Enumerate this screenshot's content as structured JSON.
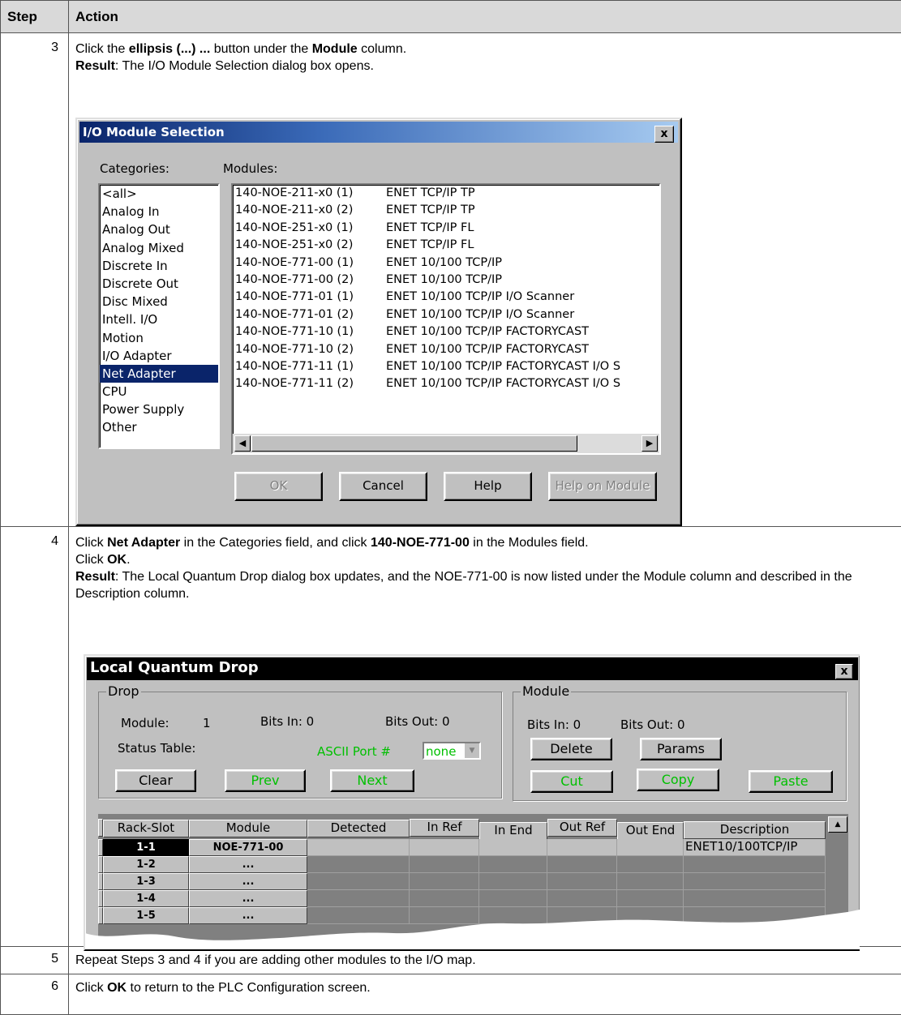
{
  "table": {
    "header": {
      "step": "Step",
      "action": "Action"
    },
    "rows": [
      {
        "step": "3",
        "l1_pre": "Click the ",
        "l1_b1": "ellipsis (...) ...",
        "l1_mid": " button under the ",
        "l1_b2": "Module",
        "l1_post": " column.",
        "l2_b": "Result",
        "l2_text": ": The I/O Module Selection dialog box opens."
      },
      {
        "step": "4",
        "l1_pre": "Click ",
        "l1_b1": "Net Adapter",
        "l1_mid": " in the Categories field, and click ",
        "l1_b2": "140-NOE-771-00",
        "l1_post": " in the Modules field.",
        "l2_pre": "Click ",
        "l2_b": "OK",
        "l2_post": ".",
        "l3_b": "Result",
        "l3_text": ": The Local Quantum Drop dialog box updates, and the NOE-771-00 is now listed under the Module column and described in the Description column."
      },
      {
        "step": "5",
        "text": "Repeat Steps 3 and 4 if you are adding other modules to the I/O map."
      },
      {
        "step": "6",
        "pre": "Click ",
        "b": "OK",
        "post": " to return to the PLC Configuration screen."
      }
    ]
  },
  "dialog1": {
    "title": "I/O Module Selection",
    "close": "x",
    "categories_label": "Categories:",
    "modules_label": "Modules:",
    "categories": [
      "<all>",
      "Analog In",
      "Analog Out",
      "Analog Mixed",
      "Discrete In",
      "Discrete Out",
      "Disc Mixed",
      "Intell. I/O",
      "Motion",
      "I/O Adapter",
      "Net Adapter",
      "CPU",
      "Power Supply",
      "Other"
    ],
    "selected_category": "Net Adapter",
    "modules": [
      [
        "140-NOE-211-x0 (1)",
        "ENET TCP/IP TP"
      ],
      [
        "140-NOE-211-x0 (2)",
        "ENET TCP/IP TP"
      ],
      [
        "140-NOE-251-x0 (1)",
        "ENET TCP/IP FL"
      ],
      [
        "140-NOE-251-x0 (2)",
        "ENET TCP/IP FL"
      ],
      [
        "140-NOE-771-00 (1)",
        "ENET 10/100 TCP/IP"
      ],
      [
        "140-NOE-771-00 (2)",
        "ENET 10/100 TCP/IP"
      ],
      [
        "140-NOE-771-01 (1)",
        "ENET 10/100 TCP/IP I/O Scanner"
      ],
      [
        "140-NOE-771-01 (2)",
        "ENET 10/100 TCP/IP I/O Scanner"
      ],
      [
        "140-NOE-771-10 (1)",
        "ENET 10/100 TCP/IP FACTORYCAST"
      ],
      [
        "140-NOE-771-10 (2)",
        "ENET 10/100 TCP/IP FACTORYCAST"
      ],
      [
        "140-NOE-771-11 (1)",
        "ENET 10/100 TCP/IP FACTORYCAST I/O S"
      ],
      [
        "140-NOE-771-11 (2)",
        "ENET 10/100 TCP/IP FACTORYCAST I/O S"
      ]
    ],
    "buttons": {
      "ok": "OK",
      "cancel": "Cancel",
      "help": "Help",
      "help_module": "Help on Module"
    },
    "colors": {
      "title_from": "#0a246a",
      "title_to": "#a6caf0"
    }
  },
  "dialog2": {
    "title": "Local Quantum Drop",
    "close": "x",
    "drop": {
      "group": "Drop",
      "module_label": "Module:",
      "module_value": "1",
      "bits_in": "Bits In: 0",
      "bits_out": "Bits Out: 0",
      "status_table": "Status Table:",
      "ascii_label": "ASCII Port #",
      "ascii_value": "none",
      "clear": "Clear",
      "prev": "Prev",
      "next": "Next"
    },
    "module": {
      "group": "Module",
      "bits_in": "Bits In: 0",
      "bits_out": "Bits Out: 0",
      "delete": "Delete",
      "params": "Params",
      "cut": "Cut",
      "copy": "Copy",
      "paste": "Paste"
    },
    "grid": {
      "columns": [
        "Rack-Slot",
        "Module",
        "Detected",
        "In Ref",
        "In End",
        "Out Ref",
        "Out End",
        "Description"
      ],
      "rows": [
        {
          "slot": "1-1",
          "module": "NOE-771-00",
          "description": "ENET10/100TCP/IP"
        },
        {
          "slot": "1-2",
          "module": "...",
          "description": ""
        },
        {
          "slot": "1-3",
          "module": "...",
          "description": ""
        },
        {
          "slot": "1-4",
          "module": "...",
          "description": ""
        },
        {
          "slot": "1-5",
          "module": "...",
          "description": ""
        }
      ]
    },
    "colors": {
      "green_text": "#00c000",
      "title_bg": "#000000"
    }
  }
}
